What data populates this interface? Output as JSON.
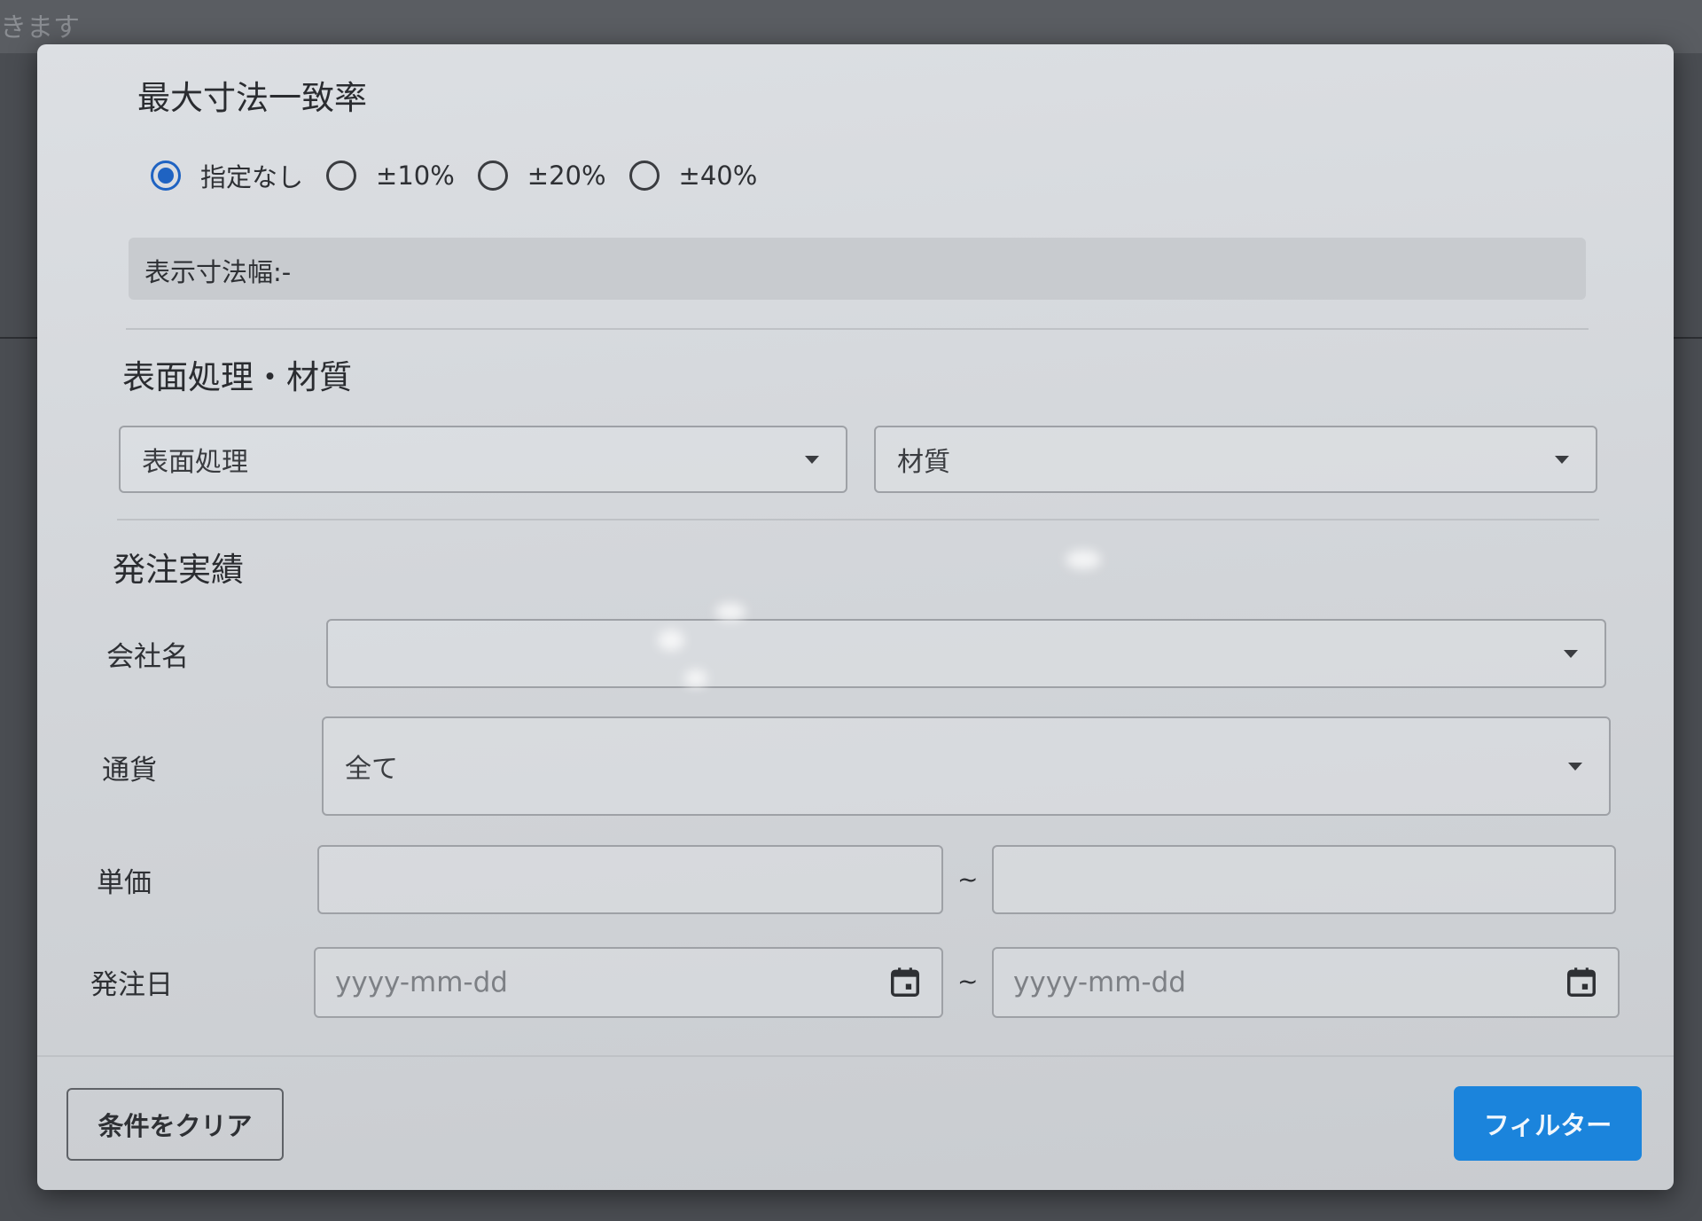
{
  "background": {
    "text": "きます"
  },
  "dimension_match": {
    "title": "最大寸法一致率",
    "options": [
      {
        "label": "指定なし",
        "selected": true
      },
      {
        "label": "±10%",
        "selected": false
      },
      {
        "label": "±20%",
        "selected": false
      },
      {
        "label": "±40%",
        "selected": false
      }
    ],
    "display_width_text": "表示寸法幅:-"
  },
  "surface_material": {
    "title": "表面処理・材質",
    "surface_treatment_value": "表面処理",
    "material_value": "材質"
  },
  "order_history": {
    "title": "発注実績",
    "company": {
      "label": "会社名",
      "value": ""
    },
    "currency": {
      "label": "通貨",
      "value": "全て"
    },
    "unit_price": {
      "label": "単価",
      "separator": "~"
    },
    "order_date": {
      "label": "発注日",
      "from_placeholder": "yyyy-mm-dd",
      "to_placeholder": "yyyy-mm-dd",
      "separator": "~"
    }
  },
  "footer": {
    "clear_label": "条件をクリア",
    "filter_label": "フィルター"
  },
  "colors": {
    "accent": "#1b84dc",
    "radio_selected": "#1f63c2"
  },
  "icons": [
    "caret-down-icon",
    "calendar-icon"
  ]
}
